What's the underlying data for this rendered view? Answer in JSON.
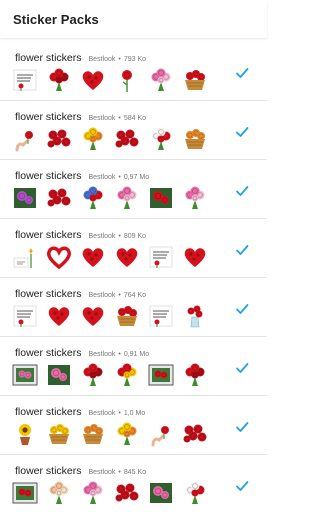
{
  "app": {
    "title": "Sticker Packs"
  },
  "colors": {
    "accent": "#1fa3e0",
    "meta": "#777777",
    "divider": "#e3e3e3"
  },
  "packs": [
    {
      "name": "flower stickers",
      "publisher": "Bestlook",
      "size": "793 Ko",
      "stickers": [
        "good-day-card",
        "red-rose-bouquet",
        "red-heart",
        "single-red-rose",
        "pink-bouquet",
        "rose-basket"
      ]
    },
    {
      "name": "flower stickers",
      "publisher": "Bestlook",
      "size": "584 Ko",
      "stickers": [
        "hands-bouquet",
        "rose-bunch",
        "yellow-bouquet",
        "red-rose-bunch",
        "white-gift-flowers",
        "mixed-basket"
      ]
    },
    {
      "name": "flower stickers",
      "publisher": "Bestlook",
      "size": "0,97 Mo",
      "stickers": [
        "purple-rose-photo",
        "red-rose-pile",
        "blue-bouquet",
        "pastel-roses",
        "red-rose-photo",
        "pink-roses"
      ]
    },
    {
      "name": "flower stickers",
      "publisher": "Bestlook",
      "size": "809 Ko",
      "stickers": [
        "tulip-card",
        "heart-wreath",
        "rose-heart",
        "rose-heart-2",
        "rose-bouquet-card",
        "red-rose-heart"
      ]
    },
    {
      "name": "flower stickers",
      "publisher": "Bestlook",
      "size": "764 Ko",
      "stickers": [
        "message-card",
        "rose-heart",
        "big-rose-heart",
        "rose-basket",
        "quote-card",
        "rose-vase"
      ]
    },
    {
      "name": "flower stickers",
      "publisher": "Bestlook",
      "size": "0,91 Mo",
      "stickers": [
        "framed-bouquet",
        "pink-bouquet-photo",
        "red-rose-bouquet",
        "mixed-bouquet",
        "framed-red-roses",
        "rose-bouquet"
      ]
    },
    {
      "name": "flower stickers",
      "publisher": "Bestlook",
      "size": "1,0 Mo",
      "stickers": [
        "sunflower-pot",
        "yellow-basket",
        "mixed-basket",
        "orange-bouquet",
        "hand-flower",
        "red-flower-bunch"
      ]
    },
    {
      "name": "flower stickers",
      "publisher": "Bestlook",
      "size": "845 Ko",
      "stickers": [
        "framed-red-flowers",
        "peach-roses",
        "pink-bouquet",
        "red-rose-pile",
        "pink-photo",
        "white-rose-bouquet"
      ]
    }
  ]
}
